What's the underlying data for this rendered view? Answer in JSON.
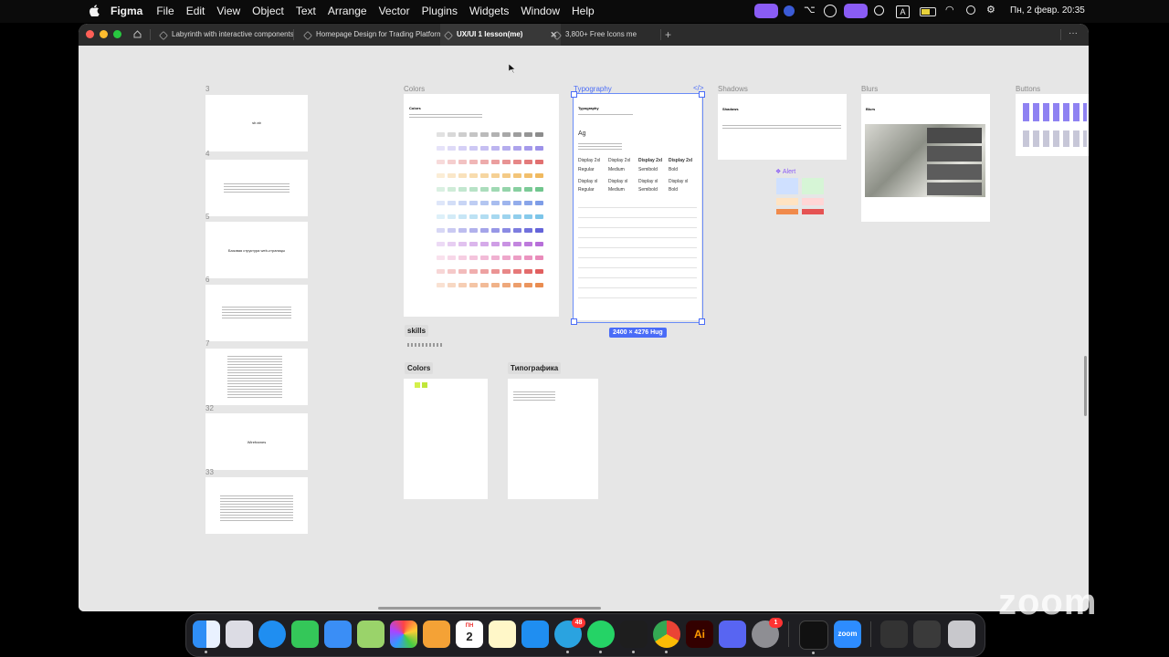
{
  "menubar": {
    "app": "Figma",
    "items": [
      "File",
      "Edit",
      "View",
      "Object",
      "Text",
      "Arrange",
      "Vector",
      "Plugins",
      "Widgets",
      "Window",
      "Help"
    ],
    "clock": "Пн, 2 февр.  20:35",
    "status_a": "A"
  },
  "tabs": [
    {
      "label": "Labyrinth with interactive components"
    },
    {
      "label": "Homepage Design for Trading Platform"
    },
    {
      "label": "UX/UI 1 lesson(me)"
    },
    {
      "label": "3,800+ Free Icons me"
    }
  ],
  "new_tab": "+",
  "more": "···",
  "close": "✕",
  "canvas": {
    "slide_numbers": [
      "3",
      "4",
      "5",
      "6",
      "7",
      "32",
      "33"
    ],
    "slide_texts": {
      "s1": "sb ab",
      "s3": "Базовая структура web-страницы",
      "s6": "Wireframes"
    },
    "frames": {
      "colors": "Colors",
      "typography": "Typography",
      "shadows": "Shadows",
      "blurs": "Blurs",
      "buttons": "Buttons",
      "alert": "Alert"
    },
    "inner": {
      "colors_title": "Colors",
      "typo_title": "Typography",
      "shadows_title": "Shadows",
      "blurs_title": "Blurs",
      "ag": "Ag",
      "typo_cells": [
        [
          "Display 2xl",
          "Display 2xl",
          "Display 2xl",
          "Display 2xl"
        ],
        [
          "Regular",
          "Medium",
          "Semibold",
          "Bold"
        ],
        [
          "Display xl",
          "Display xl",
          "Display xl",
          "Display xl"
        ],
        [
          "Regular",
          "Medium",
          "Semibold",
          "Bold"
        ]
      ]
    },
    "dimension": "2400 × 4276 Hug",
    "chips": {
      "skills": "skills",
      "colors2": "Colors",
      "typografika": "Типографика"
    }
  },
  "dock": {
    "telegram_badge": "48",
    "settings_badge": "1",
    "calendar_day": "2",
    "calendar_month": "ПН",
    "zoom_label": "zoom",
    "ai_label": "Ai"
  },
  "watermark": "zoom",
  "colors": {
    "selection": "#4a6cf7",
    "menu_pill": "#8a5cf5"
  }
}
